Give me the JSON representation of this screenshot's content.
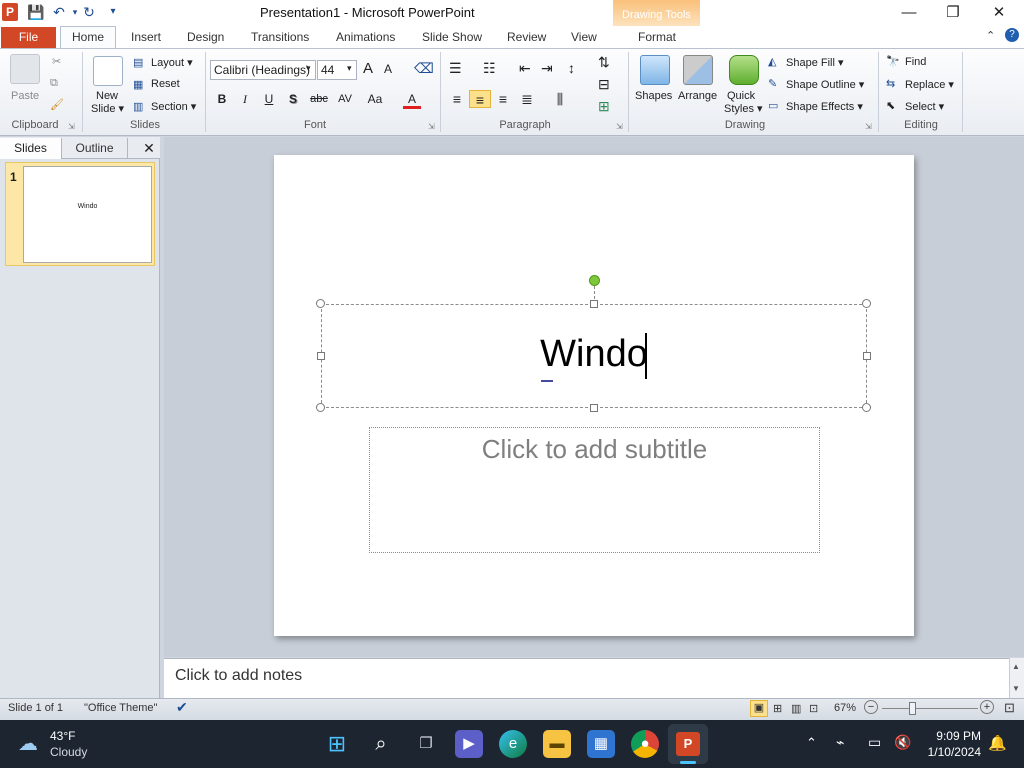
{
  "window": {
    "title": "Presentation1  -  Microsoft PowerPoint",
    "app_icon_letter": "P",
    "context_tab_group": "Drawing Tools",
    "controls": {
      "minimize": "—",
      "maximize": "❐",
      "close": "✕"
    }
  },
  "tabs": {
    "file": "File",
    "items": [
      "Home",
      "Insert",
      "Design",
      "Transitions",
      "Animations",
      "Slide Show",
      "Review",
      "View",
      "Format"
    ]
  },
  "ribbon": {
    "clipboard": {
      "paste": "Paste",
      "label": "Clipboard"
    },
    "slides": {
      "new_slide_1": "New",
      "new_slide_2": "Slide ▾",
      "layout": "Layout ▾",
      "reset": "Reset",
      "section": "Section ▾",
      "label": "Slides"
    },
    "font": {
      "name": "Calibri (Headings)",
      "size": "44",
      "grow": "A",
      "shrink": "A",
      "bold": "B",
      "italic": "I",
      "underline": "U",
      "shadow": "S",
      "strike": "abc",
      "spacing": "AV",
      "case": "Aa",
      "color": "A",
      "label": "Font"
    },
    "paragraph": {
      "label": "Paragraph"
    },
    "drawing": {
      "shapes": "Shapes",
      "arrange": "Arrange",
      "quick_styles_1": "Quick",
      "quick_styles_2": "Styles ▾",
      "shape_fill": "Shape Fill ▾",
      "shape_outline": "Shape Outline ▾",
      "shape_effects": "Shape Effects ▾",
      "label": "Drawing"
    },
    "editing": {
      "find": "Find",
      "replace": "Replace ▾",
      "select": "Select ▾",
      "label": "Editing"
    }
  },
  "left_pane": {
    "tab_slides": "Slides",
    "tab_outline": "Outline",
    "close": "✕",
    "thumb_number": "1",
    "thumb_text": "Windo"
  },
  "slide": {
    "title_text": "Windo",
    "subtitle_placeholder": "Click to add subtitle"
  },
  "notes": {
    "placeholder": "Click to add notes"
  },
  "status": {
    "slide_counter": "Slide 1 of 1",
    "theme": "\"Office Theme\"",
    "zoom": "67%",
    "zoom_level_percent": 67
  },
  "taskbar": {
    "weather_temp": "43°F",
    "weather_desc": "Cloudy",
    "time": "9:09 PM",
    "date": "1/10/2024"
  },
  "colors": {
    "accent_file": "#d24726",
    "context_tab": "#f9c07a",
    "thumb_highlight": "#fde7a6",
    "taskbar": "#1c2530"
  }
}
